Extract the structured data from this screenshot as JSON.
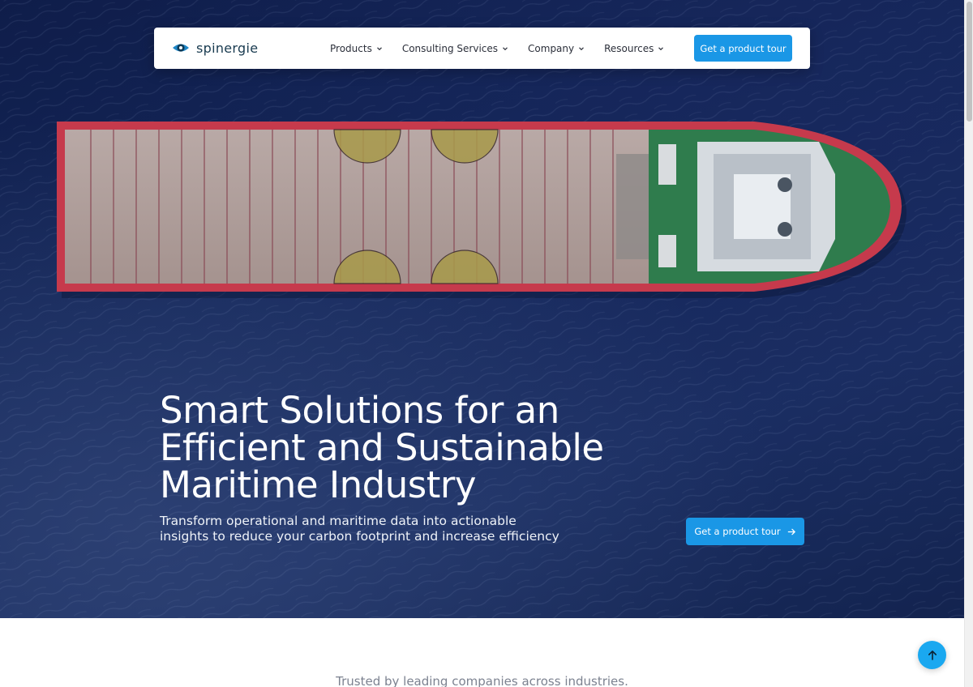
{
  "brand": {
    "name": "spinergie",
    "accent": "#1a97e6"
  },
  "nav": {
    "items": [
      {
        "label": "Products",
        "icon": "chevron-down-icon"
      },
      {
        "label": "Consulting Services",
        "icon": "chevron-down-icon"
      },
      {
        "label": "Company",
        "icon": "chevron-down-icon"
      },
      {
        "label": "Resources",
        "icon": "chevron-down-icon"
      }
    ],
    "cta_label": "Get a product tour"
  },
  "hero": {
    "headline_lines": [
      "Smart Solutions for an",
      "Efficient and Sustainable",
      "Maritime Industry"
    ],
    "subhead": "Transform operational and maritime data into actionable insights to reduce your carbon footprint and increase efficiency",
    "cta_label": "Get a product tour",
    "cta_icon": "arrow-right-icon",
    "background": "aerial-ship-on-ocean-image"
  },
  "trusted_text": "Trusted by leading companies across industries.",
  "scroll_top_icon": "arrow-up-icon"
}
